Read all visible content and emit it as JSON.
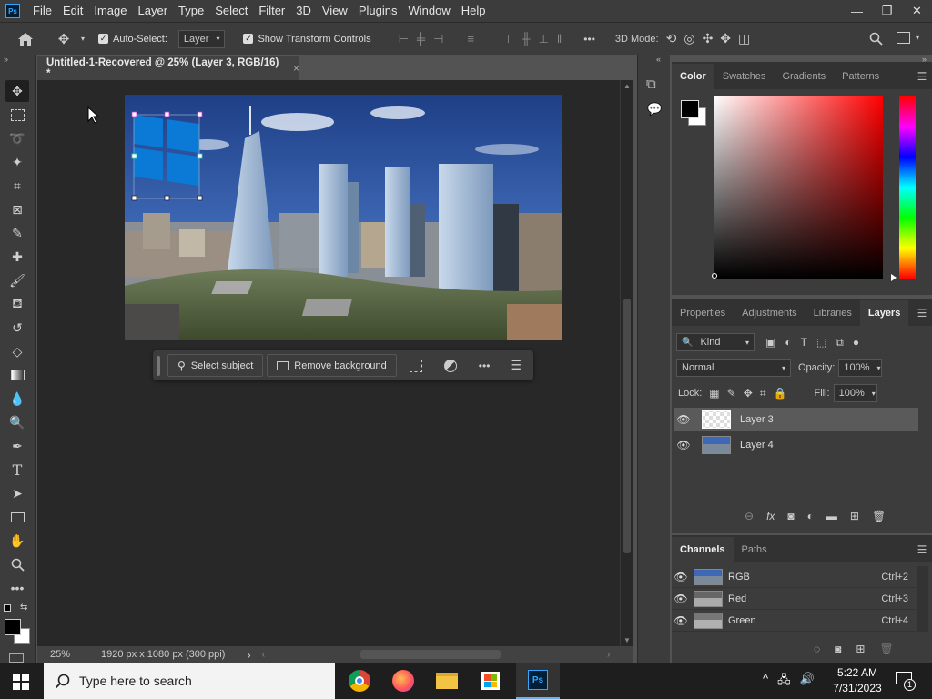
{
  "menubar": {
    "app_icon": "Ps",
    "items": [
      "File",
      "Edit",
      "Image",
      "Layer",
      "Type",
      "Select",
      "Filter",
      "3D",
      "View",
      "Plugins",
      "Window",
      "Help"
    ],
    "window_controls": [
      "minimize-icon",
      "restore-icon",
      "close-icon"
    ]
  },
  "options": {
    "auto_select_label": "Auto-Select:",
    "auto_select_value": "Layer",
    "transform_label": "Show Transform Controls",
    "mode_3d_label": "3D Mode:",
    "more_label": "•••"
  },
  "document": {
    "tab_title": "Untitled-1-Recovered @ 25% (Layer 3, RGB/16) *",
    "close_glyph": "×"
  },
  "context_bar": {
    "select_subject": "Select subject",
    "remove_background": "Remove background",
    "more": "•••"
  },
  "status": {
    "zoom": "25%",
    "doc_info": "1920 px x 1080 px (300 ppi)",
    "arrow": "›"
  },
  "color_panel": {
    "tabs": [
      "Color",
      "Swatches",
      "Gradients",
      "Patterns"
    ],
    "active_tab": "Color",
    "foreground": "#000000",
    "background": "#ffffff",
    "hue_base": "#ff0000"
  },
  "layers_panel": {
    "tabs": [
      "Properties",
      "Adjustments",
      "Libraries",
      "Layers"
    ],
    "active_tab": "Layers",
    "filter_kind": "Kind",
    "blend_mode": "Normal",
    "opacity_label": "Opacity:",
    "opacity_value": "100%",
    "lock_label": "Lock:",
    "fill_label": "Fill:",
    "fill_value": "100%",
    "layers": [
      {
        "name": "Layer 3",
        "selected": true
      },
      {
        "name": "Layer 4",
        "selected": false
      }
    ]
  },
  "channels_panel": {
    "tabs": [
      "Channels",
      "Paths"
    ],
    "active_tab": "Channels",
    "channels": [
      {
        "name": "RGB",
        "shortcut": "Ctrl+2"
      },
      {
        "name": "Red",
        "shortcut": "Ctrl+3"
      },
      {
        "name": "Green",
        "shortcut": "Ctrl+4"
      }
    ]
  },
  "taskbar": {
    "search_placeholder": "Type here to search",
    "time": "5:22 AM",
    "date": "7/31/2023",
    "notification_count": "1",
    "apps": [
      "chrome-icon",
      "firefox-icon",
      "file-explorer-icon",
      "store-icon",
      "photoshop-icon"
    ]
  }
}
